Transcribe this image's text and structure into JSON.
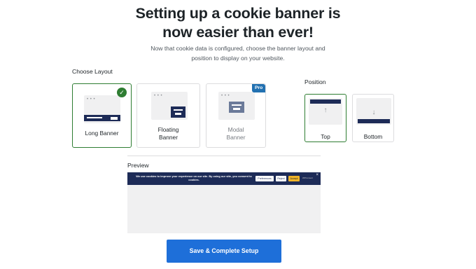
{
  "header": {
    "title_line1": "Setting up a cookie banner is",
    "title_line2": "now easier than ever!",
    "subtitle_line1": "Now that cookie data is configured, choose the banner layout and",
    "subtitle_line2": "position to display on your website."
  },
  "layout": {
    "label": "Choose Layout",
    "selected": "Long Banner",
    "options": [
      {
        "label": "Long Banner",
        "selected": true,
        "pro": false
      },
      {
        "label_line1": "Floating",
        "label_line2": "Banner",
        "selected": false,
        "pro": false
      },
      {
        "label_line1": "Modal",
        "label_line2": "Banner",
        "selected": false,
        "pro": true,
        "badge": "Pro"
      }
    ]
  },
  "position": {
    "label": "Position",
    "selected": "Top",
    "options": [
      {
        "label": "Top",
        "selected": true,
        "arrow": "↑"
      },
      {
        "label": "Bottom",
        "selected": false,
        "arrow": "↓"
      }
    ]
  },
  "preview": {
    "label": "Preview",
    "banner_text_line1": "We use cookies to improve your experience on our site. By using our site, you consent to",
    "banner_text_line2": "cookies.",
    "buttons": [
      "Preferences",
      "Reject",
      "Accept"
    ],
    "brand": "WPConsent",
    "close": "×"
  },
  "cta": {
    "label": "Save & Complete Setup"
  },
  "colors": {
    "accent_blue": "#1e6fd9",
    "selected_green": "#2e7d32",
    "banner_navy": "#1d2b57",
    "accept_yellow": "#f0b429"
  },
  "icons": {
    "check": "✓"
  }
}
